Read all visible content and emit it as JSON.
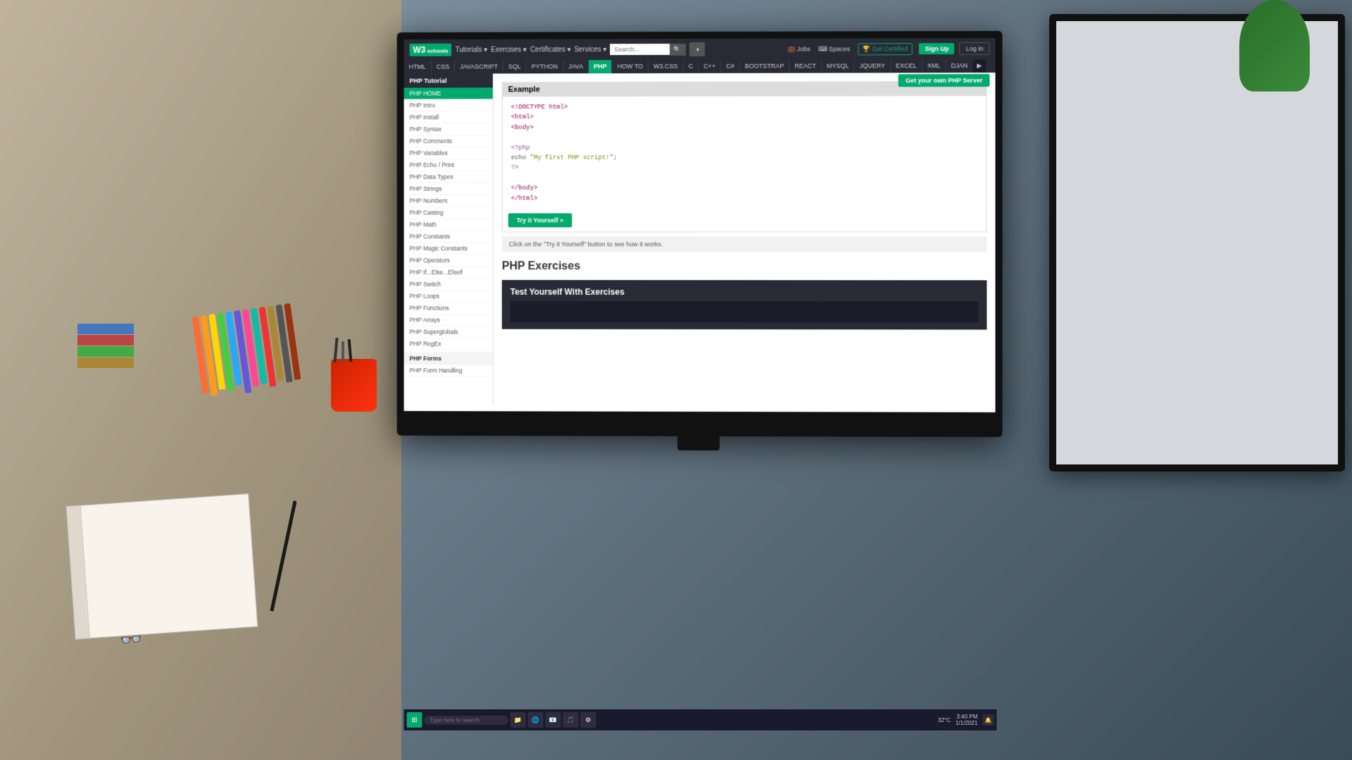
{
  "background": {
    "color": "#7a8896"
  },
  "browser": {
    "dots": [
      "#ff5f57",
      "#febc2e",
      "#28c840"
    ]
  },
  "w3schools": {
    "logo": "W3",
    "logo_sub": "schools",
    "nav": {
      "tutorials_label": "Tutorials ▾",
      "exercises_label": "Exercises ▾",
      "certificates_label": "Certificates ▾",
      "services_label": "Services ▾",
      "search_placeholder": "Search...",
      "theme_toggle": "●",
      "jobs_label": "Jobs",
      "spaces_label": "Spaces",
      "certified_label": "Get Certified",
      "signup_label": "Sign Up",
      "login_label": "Log in"
    },
    "lang_tabs_row1": [
      "HTML",
      "CSS",
      "JAVASCRIPT",
      "SQL",
      "PYTHON",
      "JAVA",
      "PHP",
      "HOW TO",
      "W3.CSS",
      "C",
      "C++",
      "C#",
      "BOOTSTRAP",
      "REACT",
      "MYSQL",
      "JQUERY",
      "EXCEL",
      "XML",
      "DJAN"
    ],
    "active_tab": "PHP",
    "sidebar": {
      "title": "PHP Tutorial",
      "items": [
        {
          "label": "PHP HOME",
          "active": true
        },
        {
          "label": "PHP Intro"
        },
        {
          "label": "PHP Install"
        },
        {
          "label": "PHP Syntax"
        },
        {
          "label": "PHP Comments"
        },
        {
          "label": "PHP Variables"
        },
        {
          "label": "PHP Echo / Print"
        },
        {
          "label": "PHP Data Types"
        },
        {
          "label": "PHP Strings"
        },
        {
          "label": "PHP Numbers"
        },
        {
          "label": "PHP Casting"
        },
        {
          "label": "PHP Math"
        },
        {
          "label": "PHP Constants"
        },
        {
          "label": "PHP Magic Constants"
        },
        {
          "label": "PHP Operators"
        },
        {
          "label": "PHP If...Else...Elseif"
        },
        {
          "label": "PHP Switch"
        },
        {
          "label": "PHP Loops"
        },
        {
          "label": "PHP Functions"
        },
        {
          "label": "PHP Arrays"
        },
        {
          "label": "PHP Superglobals"
        },
        {
          "label": "PHP RegEx"
        }
      ],
      "section_forms": "PHP Forms",
      "form_items": [
        {
          "label": "PHP Form Handling"
        }
      ]
    },
    "content": {
      "example_title": "Example",
      "code_lines": [
        "<!DOCTYPE html>",
        "<html>",
        "<body>",
        "",
        "<?php",
        "echo \"My first PHP script!\";",
        "?>",
        "",
        "</body>",
        "</html>"
      ],
      "try_btn_label": "Try it Yourself »",
      "note_text": "Click on the \"Try it Yourself\" button to see how it works.",
      "exercises_title": "PHP Exercises",
      "exercises_subtitle": "Test Yourself With Exercises",
      "php_server_banner": "Get your own PHP Server"
    }
  },
  "taskbar": {
    "search_placeholder": "Type here to search",
    "clock": "3:40 PM",
    "date": "1/1/2021",
    "temp": "32°C"
  }
}
